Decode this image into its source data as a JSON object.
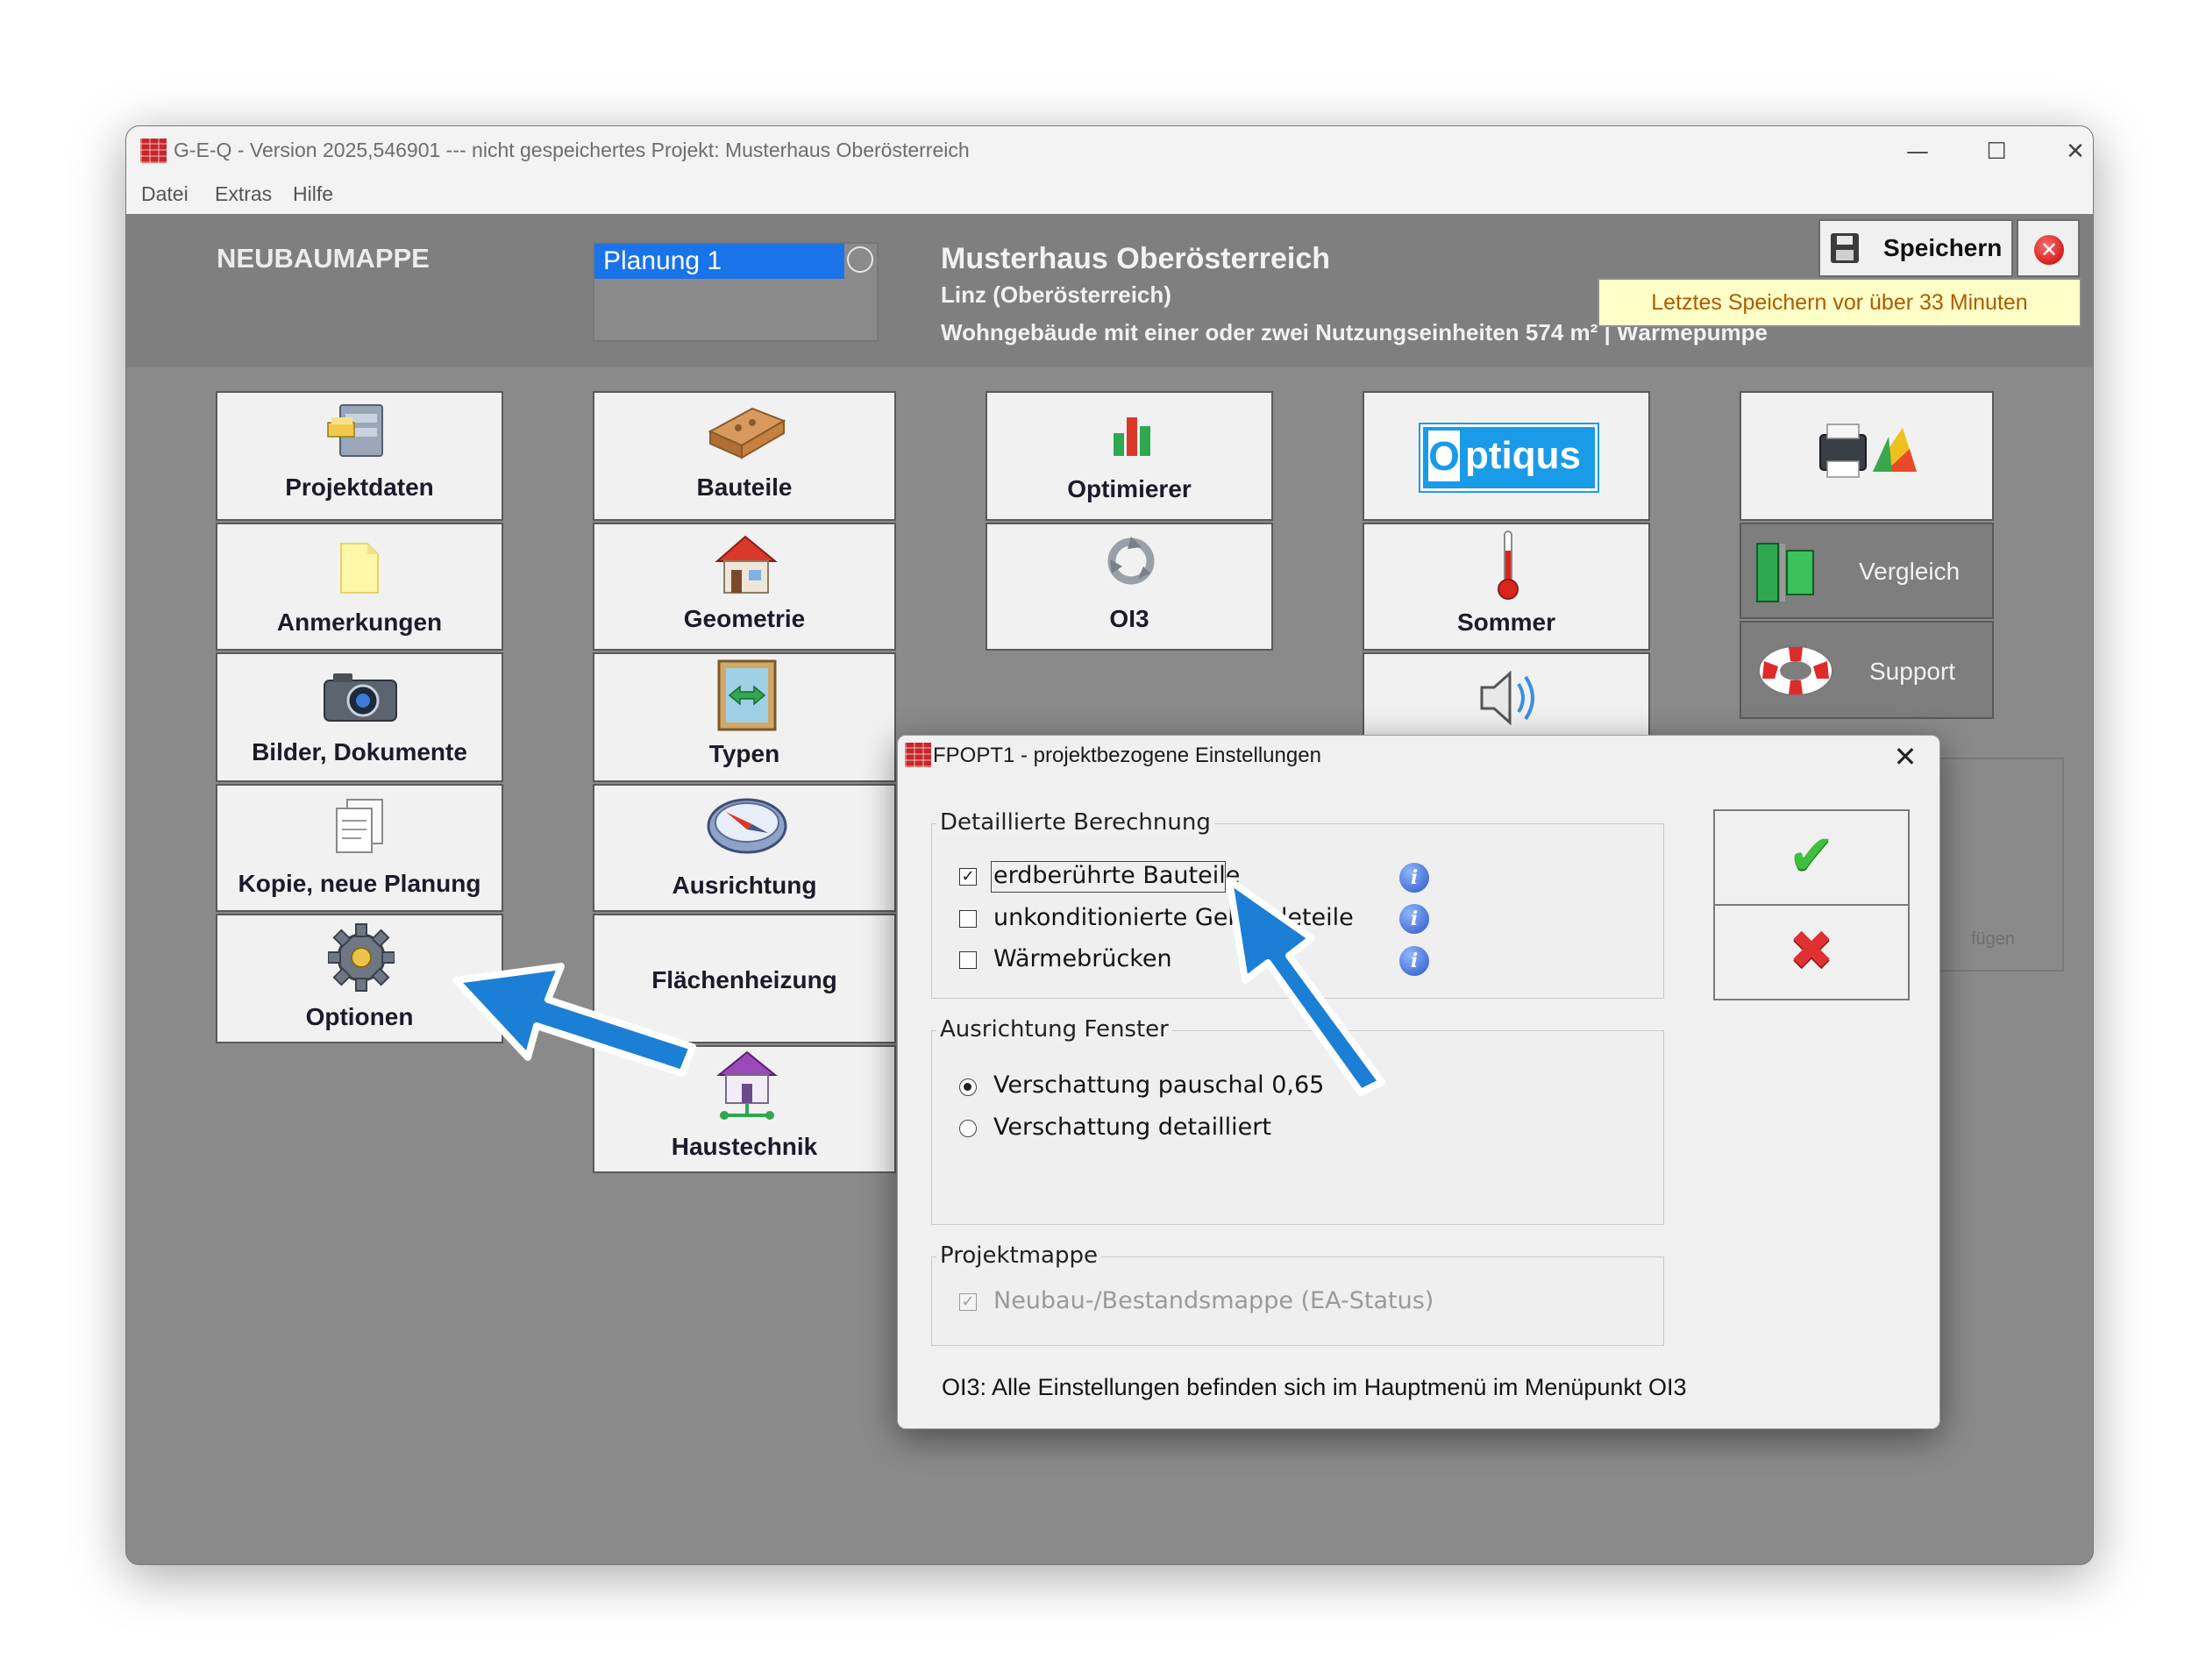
{
  "window": {
    "title": "G-E-Q - Version 2025,546901  ---  nicht gespeichertes Projekt: Musterhaus Oberösterreich",
    "controls": {
      "minimize": "—",
      "maximize": "☐",
      "close": "✕"
    }
  },
  "menu": {
    "items": [
      "Datei",
      "Extras",
      "Hilfe"
    ]
  },
  "header": {
    "mappe": "NEUBAUMAPPE",
    "planung_selected": "Planung 1",
    "project_name": "Musterhaus Oberösterreich",
    "project_location": "Linz (Oberösterreich)",
    "project_desc": "Wohngebäude mit einer oder zwei Nutzungseinheiten  574 m²  |  Wärmepumpe",
    "save_label": "Speichern",
    "save_hint": "Letztes Speichern vor über 33 Minuten"
  },
  "tiles": {
    "col1": [
      "Projektdaten",
      "Anmerkungen",
      "Bilder, Dokumente",
      "Kopie, neue Planung",
      "Optionen"
    ],
    "col2": [
      "Bauteile",
      "Geometrie",
      "Typen",
      "Ausrichtung",
      "Flächenheizung",
      "Haustechnik"
    ],
    "col3": [
      "Optimierer",
      "OI3"
    ],
    "col4": {
      "logo_o": "O",
      "logo_rest": "ptiqus",
      "sommer": "Sommer"
    },
    "col5": {
      "vergleich": "Vergleich",
      "support": "Support"
    },
    "partial_hidden_text": "fügen"
  },
  "dialog": {
    "title": "FPOPT1 - projektbezogene Einstellungen",
    "close": "✕",
    "group1": {
      "title": "Detaillierte Berechnung",
      "options": [
        {
          "label": "erdberührte Bauteile",
          "checked": "✓"
        },
        {
          "label": "unkonditionierte Gebäudeteile",
          "checked": ""
        },
        {
          "label": "Wärmebrücken",
          "checked": ""
        }
      ],
      "info": "i"
    },
    "group2": {
      "title": "Ausrichtung Fenster",
      "options": [
        {
          "label": "Verschattung pauschal 0,65",
          "selected": true
        },
        {
          "label": "Verschattung detailliert",
          "selected": false
        }
      ]
    },
    "group3": {
      "title": "Projektmappe",
      "option": {
        "label": "Neubau-/Bestandsmappe (EA-Status)",
        "checked": "✓"
      }
    },
    "ok": "✔",
    "cancel": "✖",
    "footer": "OI3: Alle Einstellungen befinden sich im Hauptmenü im Menüpunkt OI3"
  },
  "colors": {
    "accent_blue": "#1a73e8",
    "arrow_blue": "#1c7fd6",
    "background_gray": "#8a8a8a",
    "hint_yellow": "#ffffc8",
    "ok_green": "#3fbf3f",
    "cancel_red": "#e03030"
  }
}
